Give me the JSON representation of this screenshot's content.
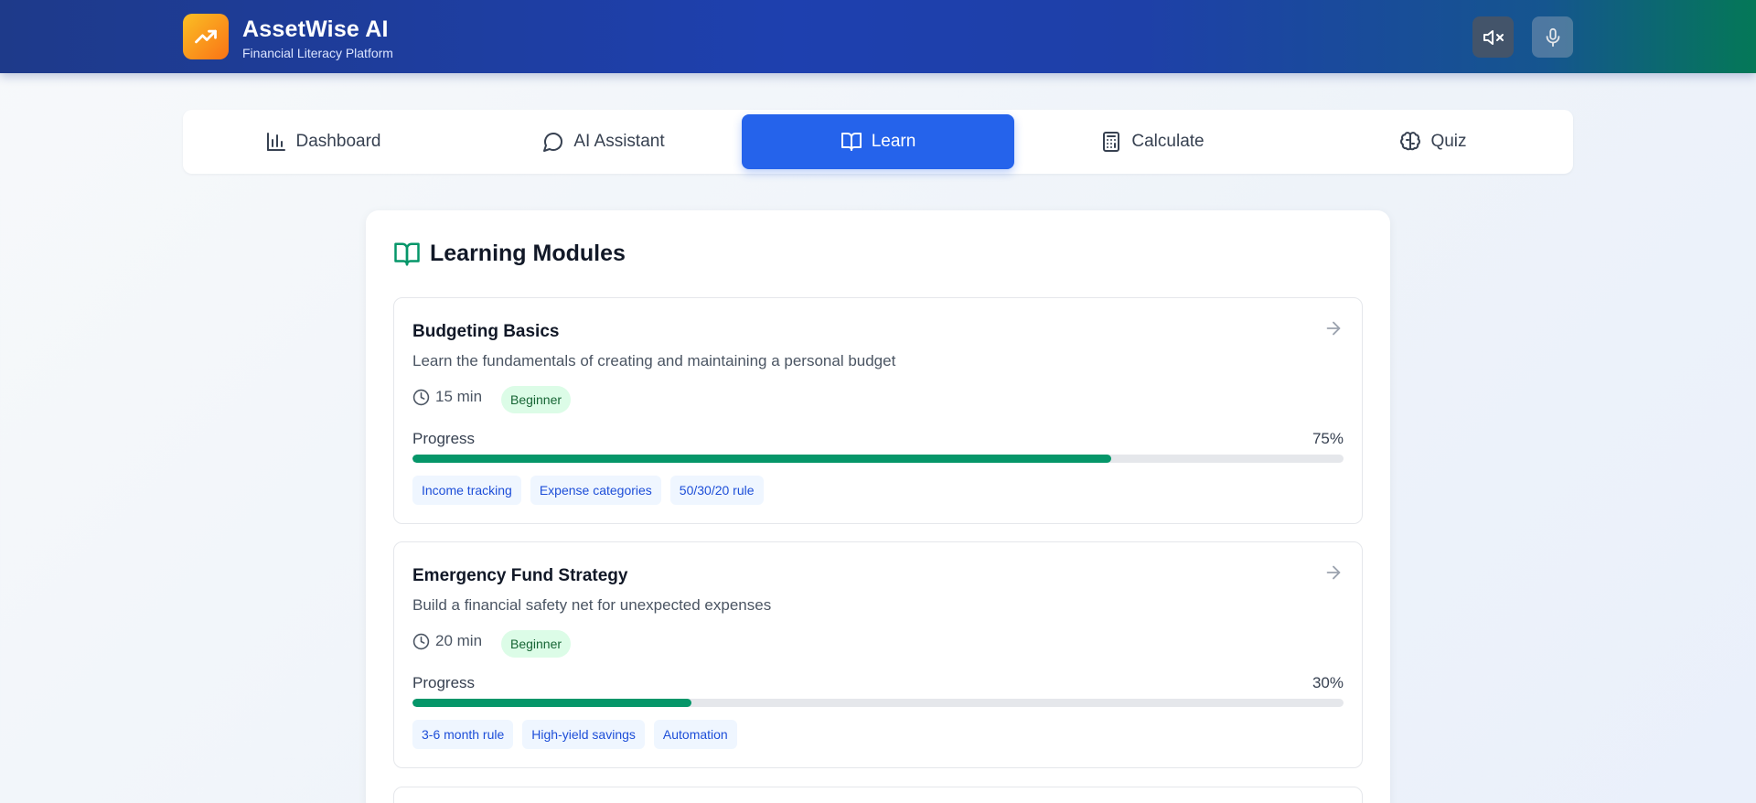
{
  "header": {
    "title": "AssetWise AI",
    "subtitle": "Financial Literacy Platform",
    "logo_icon": "trending-up-icon",
    "buttons": [
      {
        "name": "mute",
        "icon": "volume-x-icon"
      },
      {
        "name": "microphone",
        "icon": "mic-icon"
      }
    ],
    "colors": {
      "gradient_start": "#1e3a8a",
      "gradient_end": "#047857",
      "logo_start": "#fbbf24",
      "logo_end": "#f97316"
    }
  },
  "tabs": [
    {
      "label": "Dashboard",
      "icon": "bar-chart-icon",
      "active": false
    },
    {
      "label": "AI Assistant",
      "icon": "message-circle-icon",
      "active": false
    },
    {
      "label": "Learn",
      "icon": "book-open-icon",
      "active": true
    },
    {
      "label": "Calculate",
      "icon": "calculator-icon",
      "active": false
    },
    {
      "label": "Quiz",
      "icon": "brain-icon",
      "active": false
    }
  ],
  "main": {
    "title": "Learning Modules",
    "title_icon": "book-open-icon",
    "modules": [
      {
        "title": "Budgeting Basics",
        "description": "Learn the fundamentals of creating and maintaining a personal budget",
        "duration": "15 min",
        "level": "Beginner",
        "progress_label": "Progress",
        "progress_text": "75%",
        "progress": 0.75,
        "topics": [
          "Income tracking",
          "Expense categories",
          "50/30/20 rule"
        ]
      },
      {
        "title": "Emergency Fund Strategy",
        "description": "Build a financial safety net for unexpected expenses",
        "duration": "20 min",
        "level": "Beginner",
        "progress_label": "Progress",
        "progress_text": "30%",
        "progress": 0.3,
        "topics": [
          "3-6 month rule",
          "High-yield savings",
          "Automation"
        ]
      }
    ]
  },
  "colors": {
    "accent": "#2563eb",
    "progress": "#059669",
    "badge_bg": "#dcfce7",
    "badge_text": "#166534",
    "topic_bg": "#eff6ff",
    "topic_text": "#1d4ed8"
  }
}
